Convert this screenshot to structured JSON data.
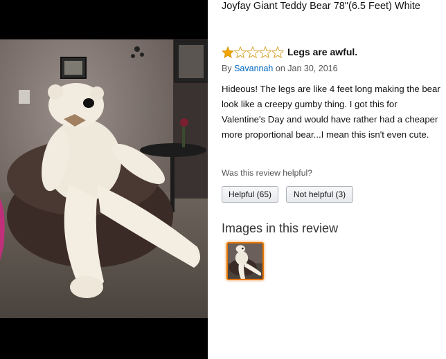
{
  "product": {
    "title": "Joyfay Giant Teddy Bear 78\"(6.5 Feet) White"
  },
  "review": {
    "rating": 1,
    "rating_max": 5,
    "star_color": "#f0a500",
    "title": "Legs are awful.",
    "by_label": "By",
    "author": "Savannah",
    "on_label": "on",
    "date": "Jan 30, 2016",
    "body": "Hideous! The legs are like 4 feet long making the bear look like a creepy gumby thing. I got this for Valentine's Day and would have rather had a cheaper more proportional bear...I mean this isn't even cute."
  },
  "helpful": {
    "question": "Was this review helpful?",
    "helpful_label": "Helpful (65)",
    "not_helpful_label": "Not helpful (3)"
  },
  "images_section": {
    "heading": "Images in this review",
    "selected_color": "#e77600"
  }
}
